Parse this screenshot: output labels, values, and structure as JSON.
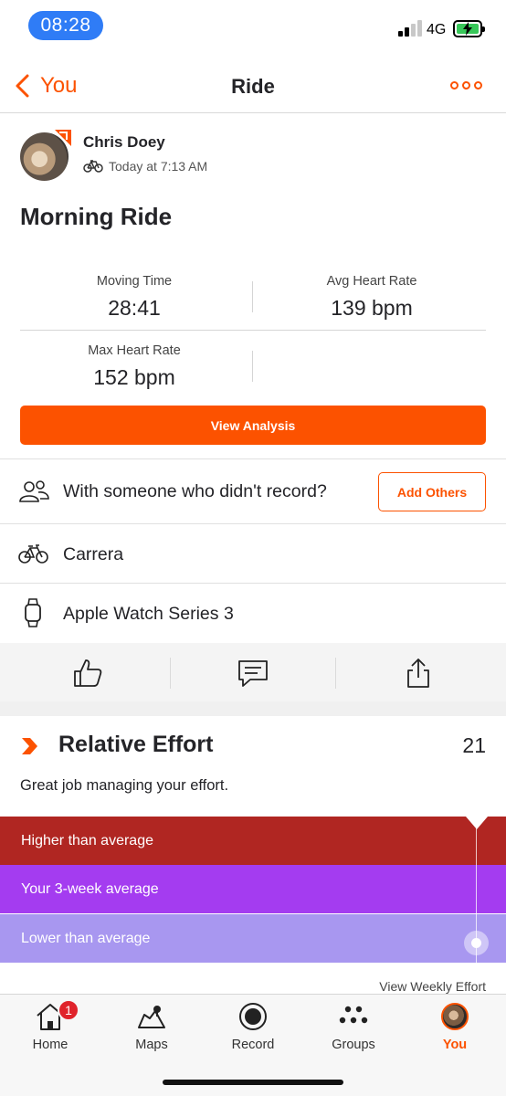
{
  "status_bar": {
    "time": "08:28",
    "network": "4G",
    "signal_bars": 2,
    "battery_charging": true
  },
  "nav": {
    "back_label": "You",
    "title": "Ride"
  },
  "athlete": {
    "name": "Chris Doey",
    "activity_meta": "Today at 7:13 AM"
  },
  "activity": {
    "title": "Morning Ride"
  },
  "stats": [
    {
      "label": "Moving Time",
      "value": "28:41"
    },
    {
      "label": "Avg Heart Rate",
      "value": "139 bpm"
    },
    {
      "label": "Max Heart Rate",
      "value": "152 bpm"
    }
  ],
  "analysis_button": "View Analysis",
  "rows": {
    "group_prompt": "With someone who didn't record?",
    "add_others": "Add Others",
    "gear": "Carrera",
    "device": "Apple Watch Series 3"
  },
  "relative_effort": {
    "title": "Relative Effort",
    "value": "21",
    "description": "Great job managing your effort.",
    "bands": [
      {
        "label": "Higher than average",
        "color": "#b02622"
      },
      {
        "label": "Your 3-week average",
        "color": "#a43cf0"
      },
      {
        "label": "Lower than average",
        "color": "#a897f0"
      }
    ],
    "weekly_link": "View Weekly Effort"
  },
  "tabs": [
    {
      "label": "Home",
      "icon": "home-icon",
      "badge": "1"
    },
    {
      "label": "Maps",
      "icon": "map-icon"
    },
    {
      "label": "Record",
      "icon": "record-icon"
    },
    {
      "label": "Groups",
      "icon": "groups-icon"
    },
    {
      "label": "You",
      "icon": "avatar",
      "active": true
    }
  ],
  "colors": {
    "accent": "#fc5200",
    "text": "#242428",
    "time_pill": "#2f7cf6"
  }
}
